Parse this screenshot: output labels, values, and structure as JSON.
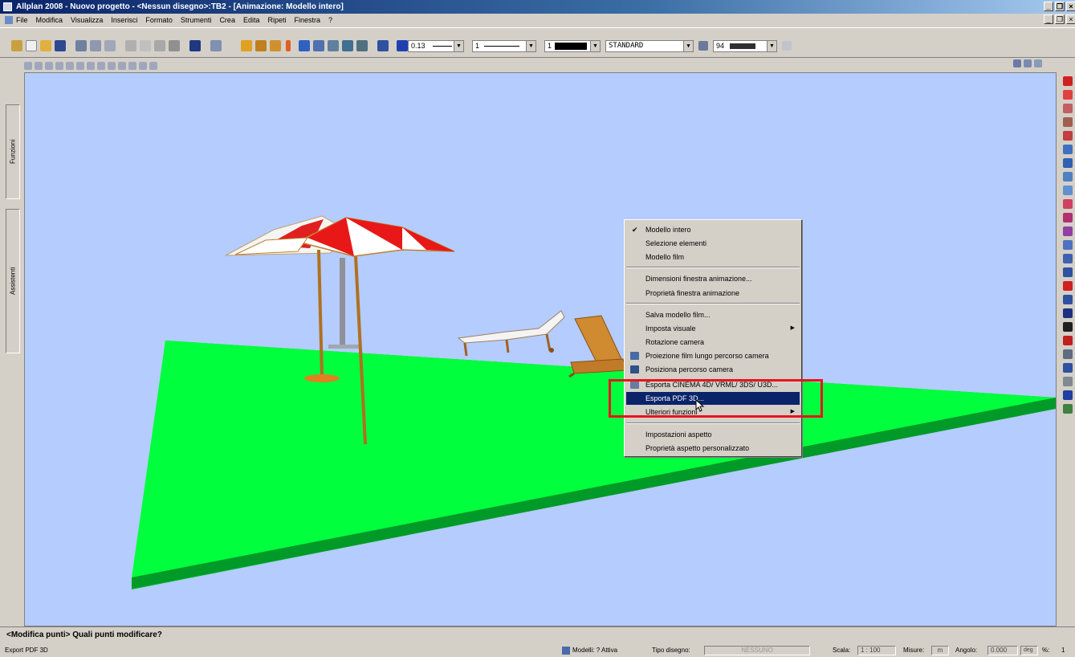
{
  "window": {
    "title": "Allplan 2008 - Nuovo progetto - <Nessun disegno>:TB2 - [Animazione: Modello intero]"
  },
  "menubar": {
    "items": [
      "File",
      "Modifica",
      "Visualizza",
      "Inserisci",
      "Formato",
      "Strumenti",
      "Crea",
      "Edita",
      "Ripeti",
      "Finestra",
      "?"
    ]
  },
  "toolbar": {
    "pen_value": "0.13",
    "line_value": "1",
    "color_value": "1",
    "layer_value": "STANDARD",
    "scale_value": "94"
  },
  "side_tabs": {
    "functions": "Funzioni",
    "assistants": "Assistenti"
  },
  "context_menu": {
    "items": [
      {
        "label": "Modello intero",
        "checked": true
      },
      {
        "label": "Selezione elementi"
      },
      {
        "label": "Modello film"
      },
      {
        "label": "Dimensioni finestra animazione..."
      },
      {
        "label": "Proprietà finestra animazione"
      },
      {
        "label": "Salva modello film..."
      },
      {
        "label": "Imposta visuale",
        "submenu": true
      },
      {
        "label": "Rotazione camera"
      },
      {
        "label": "Proiezione film lungo percorso camera",
        "icon": "film-icon"
      },
      {
        "label": "Posiziona percorso camera",
        "icon": "camera-path-icon"
      },
      {
        "label": "Esporta CINEMA 4D/ VRML/ 3DS/ U3D...",
        "icon": "export-icon"
      },
      {
        "label": "Esporta PDF 3D...",
        "active": true
      },
      {
        "label": "Ulteriori funzioni",
        "submenu": true
      },
      {
        "label": "Impostazioni aspetto"
      },
      {
        "label": "Proprietà aspetto personalizzato"
      }
    ]
  },
  "command_line": {
    "prompt": "<Modifica punti> Quali punti modificare?"
  },
  "status_bar": {
    "left_text": "Export PDF 3D",
    "modelli_label": "Modelli: ? Attiva",
    "tipo_disegno_label": "Tipo disegno:",
    "tipo_disegno_value": "NESSUNO",
    "scala_label": "Scala:",
    "scala_value": "1 : 100",
    "misure_label": "Misure:",
    "misure_value": "m",
    "angolo_label": "Angolo:",
    "angolo_value": "0.000",
    "angolo_unit": "deg",
    "percent_label": "%:",
    "percent_value": "1"
  },
  "colors": {
    "viewport_bg": "#b4ccfe",
    "ground": "#00ff3c",
    "menu_highlight": "#0a246a",
    "annotation_box": "#e8141e"
  }
}
